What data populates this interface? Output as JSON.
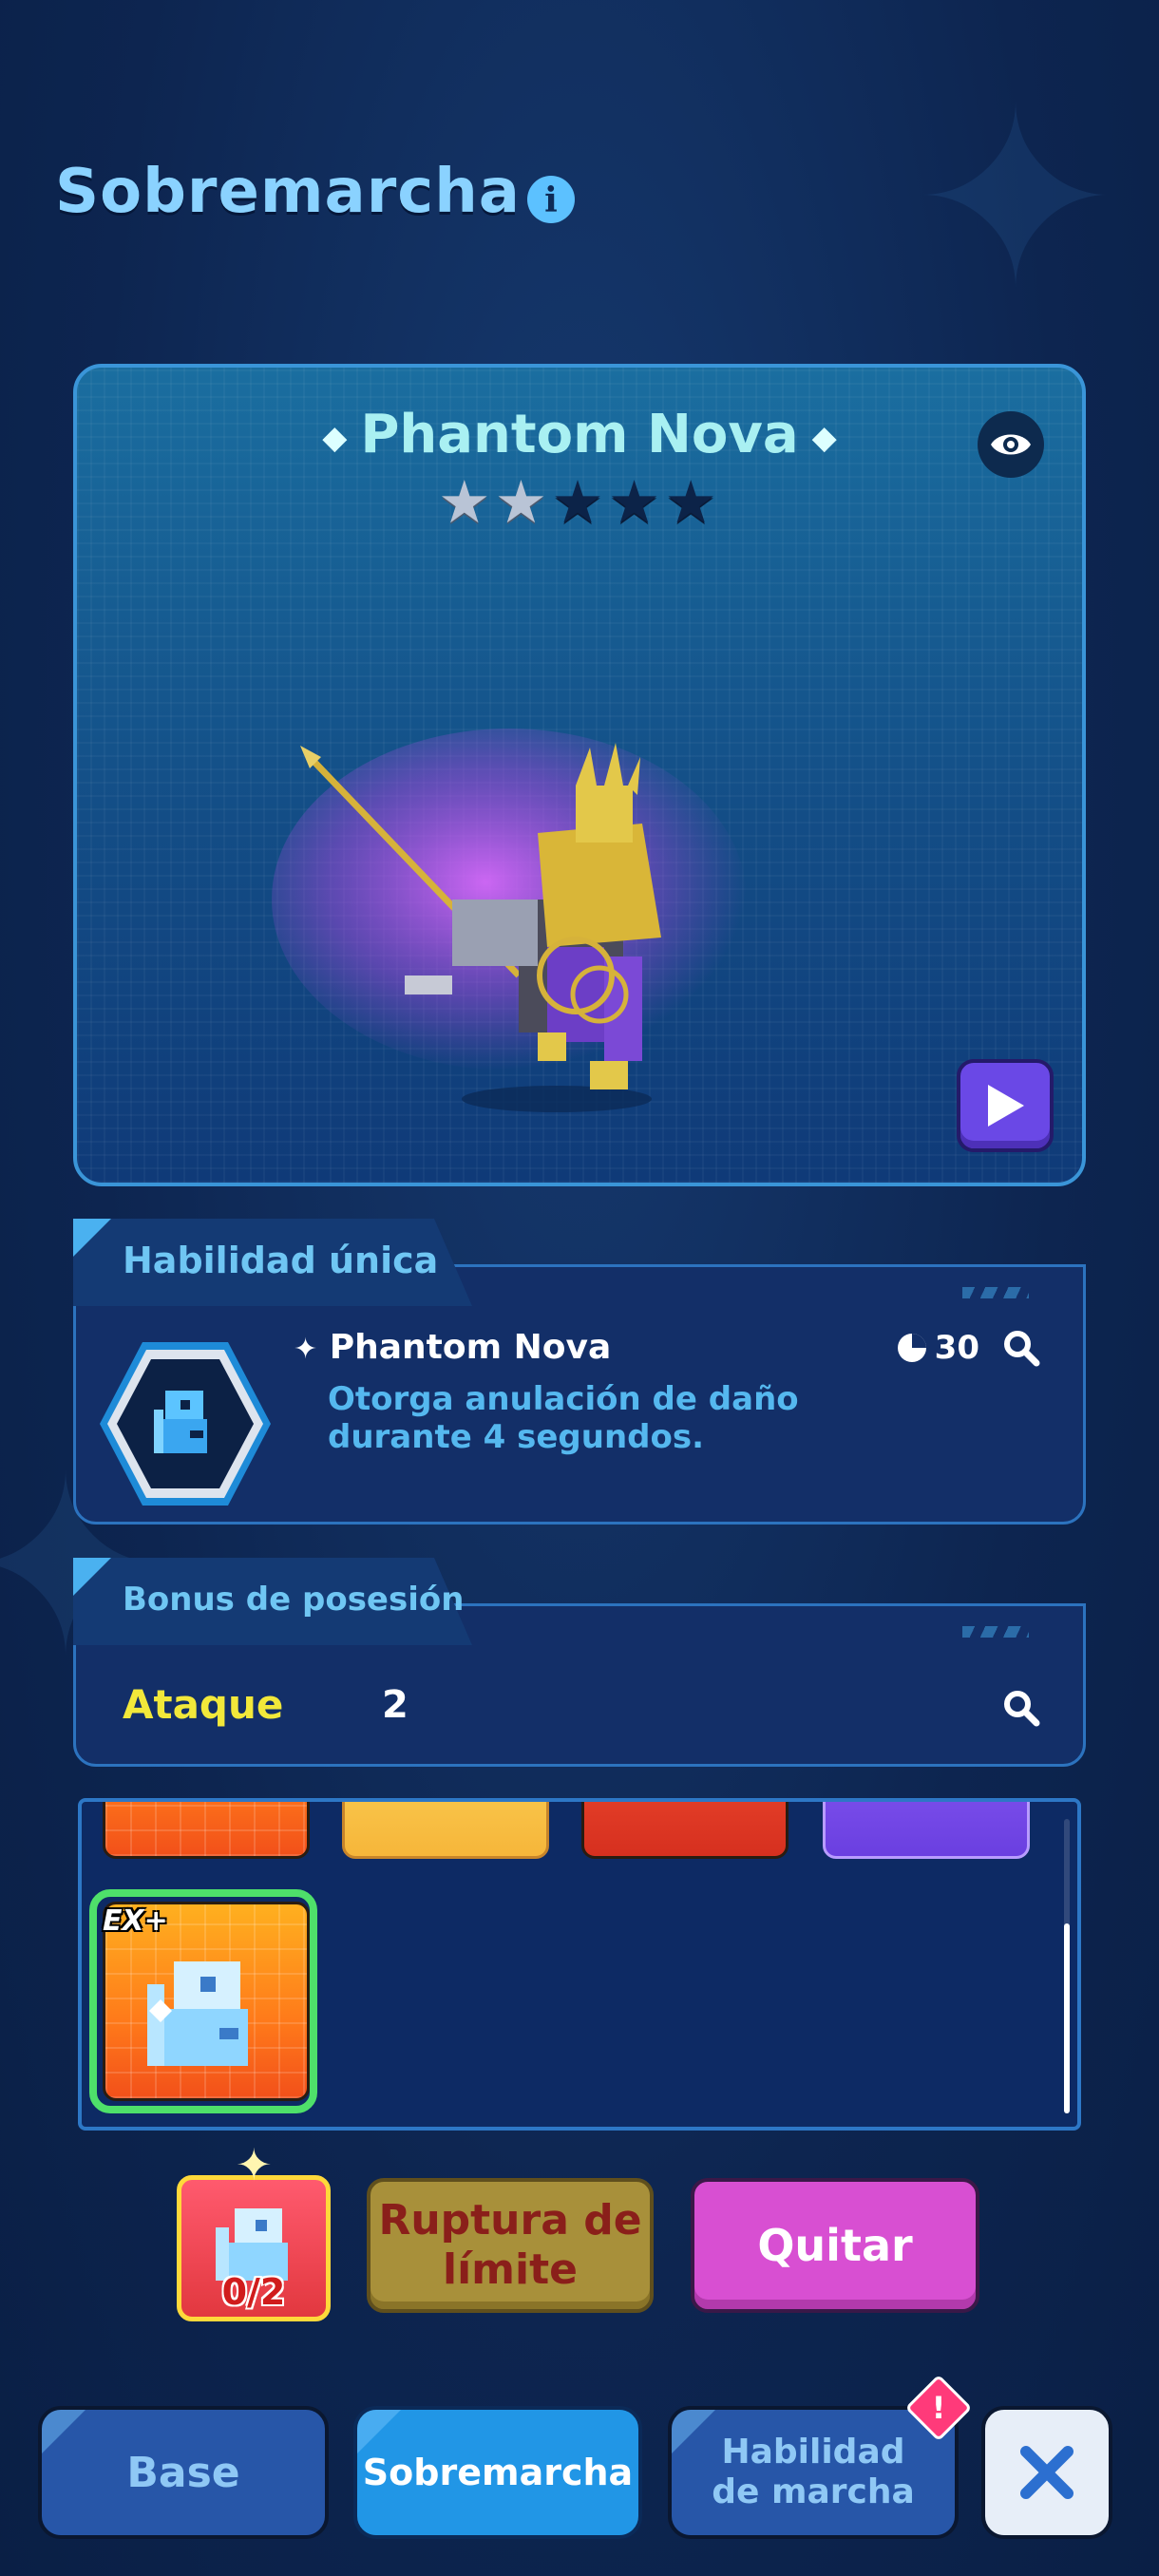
{
  "header": {
    "title": "Sobremarcha",
    "info_icon": "info-icon"
  },
  "hero": {
    "name": "Phantom Nova",
    "stars_filled": 2,
    "stars_total": 5,
    "view_icon": "eye-icon",
    "play_icon": "play-icon"
  },
  "unique_skill": {
    "section_title": "Habilidad única",
    "skill_name": "Phantom Nova",
    "cooldown": "30",
    "description": "Otorga anulación de daño durante 4 segundos."
  },
  "possession_bonus": {
    "section_title": "Bonus de posesión",
    "stat_label": "Ataque",
    "stat_value": "2"
  },
  "grid": {
    "selected_badge": "EX+"
  },
  "actions": {
    "item_count": "0/2",
    "limit_break_label": "Ruptura de límite",
    "remove_label": "Quitar"
  },
  "nav": {
    "base_label": "Base",
    "overdrive_label": "Sobremarcha",
    "march_skill_label": "Habilidad de marcha",
    "close_icon": "close-icon",
    "alert_mark": "!"
  },
  "colors": {
    "title": "#8ad2ff",
    "accent_cyan": "#a9f0f2",
    "stat_label": "#f2e83a",
    "remove_button": "#d84fd2",
    "limit_button": "#a8903a"
  }
}
